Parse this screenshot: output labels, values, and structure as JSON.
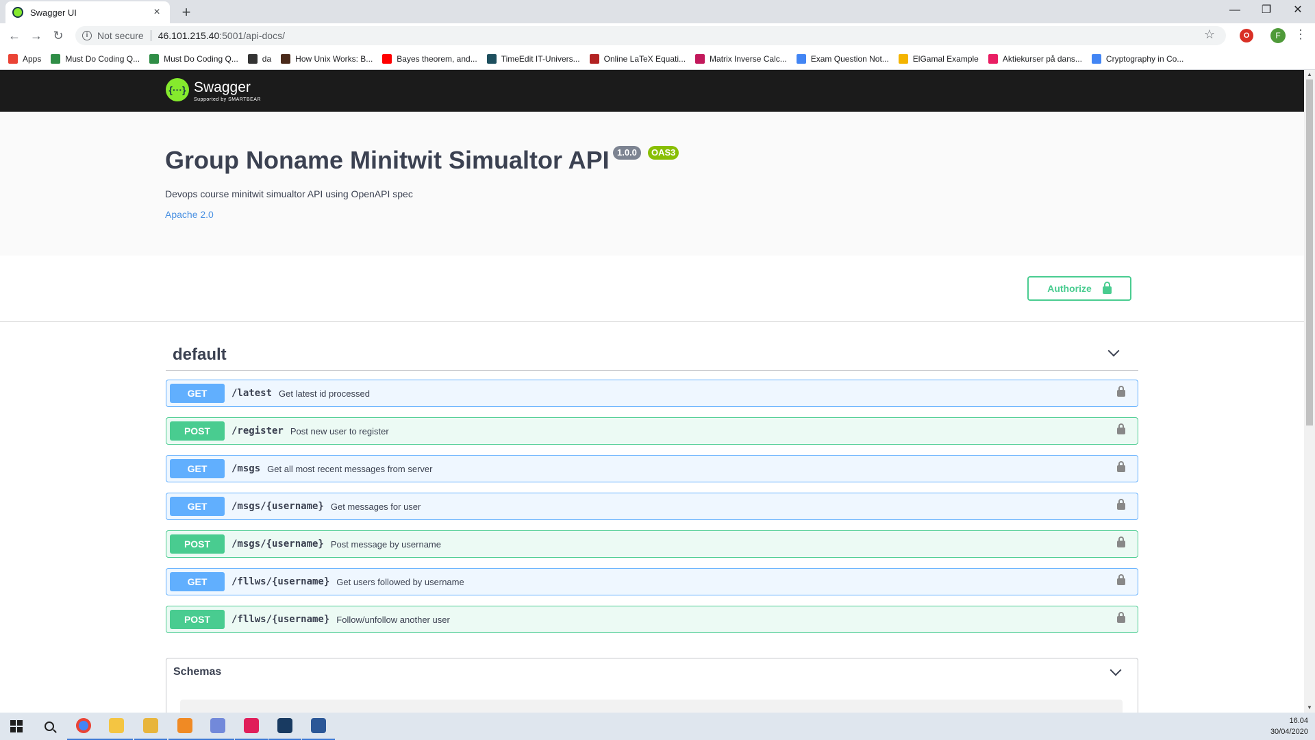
{
  "browser": {
    "tab_title": "Swagger UI",
    "tab_close": "×",
    "new_tab": "+",
    "window_controls": {
      "minimize": "—",
      "restore": "❐",
      "close": "✕"
    },
    "nav": {
      "back": "←",
      "forward": "→",
      "reload": "↻"
    },
    "security_label": "Not secure",
    "url_host": "46.101.215.40",
    "url_path": ":5001/api-docs/",
    "star": "☆",
    "extension_letter": "O",
    "profile_letter": "F",
    "menu": "⋮"
  },
  "bookmarks": [
    {
      "label": "Apps",
      "color": "#ea4335"
    },
    {
      "label": "Must Do Coding Q...",
      "color": "#2f8d46"
    },
    {
      "label": "Must Do Coding Q...",
      "color": "#2f8d46"
    },
    {
      "label": "da",
      "color": "#333333"
    },
    {
      "label": "How Unix Works: B...",
      "color": "#4a2a1a"
    },
    {
      "label": "Bayes theorem, and...",
      "color": "#ff0000"
    },
    {
      "label": "TimeEdit IT-Univers...",
      "color": "#1d4f5e"
    },
    {
      "label": "Online LaTeX Equati...",
      "color": "#b22222"
    },
    {
      "label": "Matrix Inverse Calc...",
      "color": "#c2185b"
    },
    {
      "label": "Exam Question Not...",
      "color": "#4285f4"
    },
    {
      "label": "ElGamal Example",
      "color": "#f4b400"
    },
    {
      "label": "Aktiekurser på dans...",
      "color": "#e91e63"
    },
    {
      "label": "Cryptography in Co...",
      "color": "#4285f4"
    }
  ],
  "swagger": {
    "logo_glyph": "{···}",
    "brand": "Swagger",
    "brand_sub": "Supported by SMARTBEAR",
    "title": "Group Noname Minitwit Simualtor API",
    "version": "1.0.0",
    "oas": "OAS3",
    "description": "Devops course minitwit simualtor API using OpenAPI spec",
    "license": "Apache 2.0",
    "authorize_label": "Authorize",
    "tag": "default",
    "operations": [
      {
        "method": "GET",
        "path": "/latest",
        "summary": "Get latest id processed"
      },
      {
        "method": "POST",
        "path": "/register",
        "summary": "Post new user to register"
      },
      {
        "method": "GET",
        "path": "/msgs",
        "summary": "Get all most recent messages from server"
      },
      {
        "method": "GET",
        "path": "/msgs/{username}",
        "summary": "Get messages for user"
      },
      {
        "method": "POST",
        "path": "/msgs/{username}",
        "summary": "Post message by username"
      },
      {
        "method": "GET",
        "path": "/fllws/{username}",
        "summary": "Get users followed by username"
      },
      {
        "method": "POST",
        "path": "/fllws/{username}",
        "summary": "Follow/unfollow another user"
      }
    ],
    "schemas_label": "Schemas"
  },
  "colors": {
    "get": "#61affe",
    "post": "#49cc90",
    "brand_green": "#85ea2d"
  },
  "taskbar": {
    "apps": [
      "windows-start",
      "search",
      "chrome",
      "file-explorer",
      "sourcetree",
      "sublime",
      "discord",
      "slack",
      "virtualbox",
      "editor"
    ],
    "time": "16.04",
    "date": "30/04/2020"
  }
}
